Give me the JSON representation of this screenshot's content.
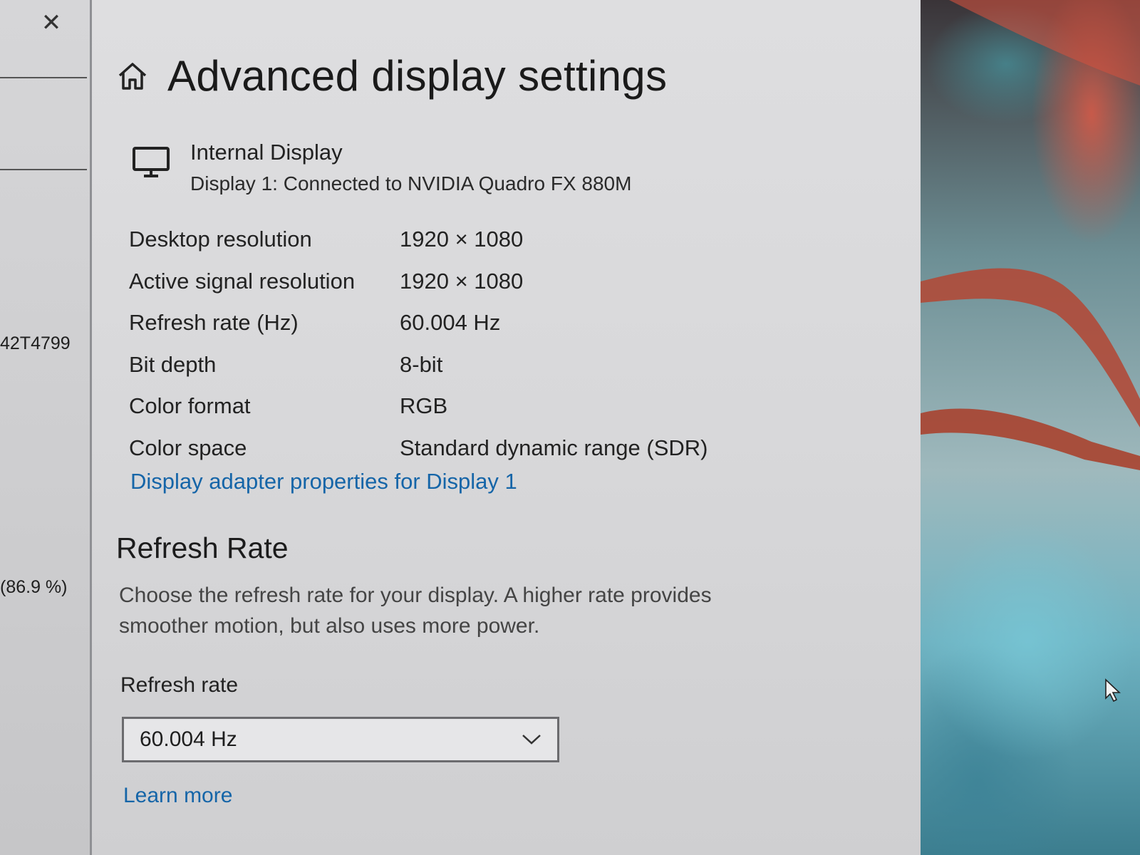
{
  "background_window": {
    "close_glyph": "✕",
    "text_fragments": [
      "42T4799",
      "(86.9 %)"
    ]
  },
  "header": {
    "title": "Advanced display settings"
  },
  "display": {
    "name": "Internal Display",
    "subtitle": "Display 1: Connected to NVIDIA Quadro FX 880M"
  },
  "properties": [
    {
      "label": "Desktop resolution",
      "value": "1920 × 1080"
    },
    {
      "label": "Active signal resolution",
      "value": "1920 × 1080"
    },
    {
      "label": "Refresh rate (Hz)",
      "value": "60.004 Hz"
    },
    {
      "label": "Bit depth",
      "value": "8-bit"
    },
    {
      "label": "Color format",
      "value": "RGB"
    },
    {
      "label": "Color space",
      "value": "Standard dynamic range (SDR)"
    }
  ],
  "adapter_link": "Display adapter properties for Display 1",
  "refresh_section": {
    "title": "Refresh Rate",
    "description": "Choose the refresh rate for your display. A higher rate provides smoother motion, but also uses more power.",
    "field_label": "Refresh rate",
    "selected_value": "60.004 Hz",
    "learn_more": "Learn more"
  },
  "colors": {
    "link": "#1565a8",
    "panel_bg": "#dcdcde",
    "text": "#1f1f1f"
  },
  "icons": [
    "home-icon",
    "monitor-icon",
    "chevron-down-icon",
    "close-icon",
    "cursor-icon"
  ]
}
